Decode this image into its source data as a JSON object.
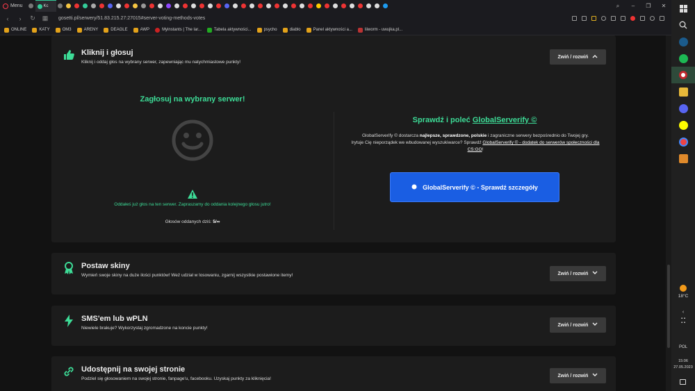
{
  "browser": {
    "menu_label": "Menu",
    "active_tab_label": "Kc",
    "url": "gosetti.pl/serwery/51.83.215.27:27015#server-voting-methods-votes",
    "bookmarks": [
      "ONLINE",
      "KATY",
      "OM3",
      "ARENY",
      "DEAGLE",
      "AWP",
      "Myinstants | The lar...",
      "Tabela aktywności...",
      "psycho",
      "diablo",
      "Panel aktywności a...",
      "liiworm - uwujka.pl..."
    ]
  },
  "cards": {
    "vote": {
      "title": "Kliknij i głosuj",
      "subtitle": "Kliknij i oddaj głos na wybrany serwer, zapewniając mu natychmiastowe punkty!",
      "toggle_label": "Zwiń / rozwiń"
    },
    "skins": {
      "title": "Postaw skiny",
      "subtitle": "Wymień swoje skiny na duże ilości punktów! Weź udział w losowaniu, zgarnij wszystkie postawione itemy!",
      "toggle_label": "Zwiń / rozwiń"
    },
    "sms": {
      "title": "SMS'em lub wPLN",
      "subtitle": "Niewiele brakuje? Wykorzystaj zgromadzone na koncie punkty!",
      "toggle_label": "Zwiń / rozwiń"
    },
    "share": {
      "title": "Udostępnij na swojej stronie",
      "subtitle": "Podziel się głosowaniem na swojej stronie, fanpage'u, facebooku. Uzyskaj punkty za kliknięcia!",
      "toggle_label": "Zwiń / rozwiń"
    }
  },
  "vote_panel": {
    "title": "Zagłosuj na wybrany serwer!",
    "message": "Oddałeś już głos na ten serwer. Zapraszamy do oddania kolejnego głosu jutro!",
    "count_label": "Głosów oddanych dziś:",
    "count_value": "5/∞"
  },
  "promo": {
    "title_prefix": "Sprawdź i poleć ",
    "title_link": "GlobalServerify ©",
    "text_1": "GlobalServerify © dostarcza ",
    "text_bold": "najlepsze, sprawdzone, polskie",
    "text_2": " i zagraniczne serwery bezpośrednio do Twojej gry.",
    "text_3": "Irytuje Cię nieporządek we wbudowanej wyszukiwarce? Sprawdź ",
    "text_link": "GlobalServerify © - dodatek do serwerów społeczności dla CS:GO",
    "text_4": "!",
    "button_label": "GlobalServerify © - Sprawdź szczegóły"
  },
  "system": {
    "temperature": "18°C",
    "language": "POL",
    "time": "15:06",
    "date": "27.05.2023"
  },
  "colors": {
    "accent_green": "#3ddc97",
    "button_blue": "#1a5ee3"
  }
}
